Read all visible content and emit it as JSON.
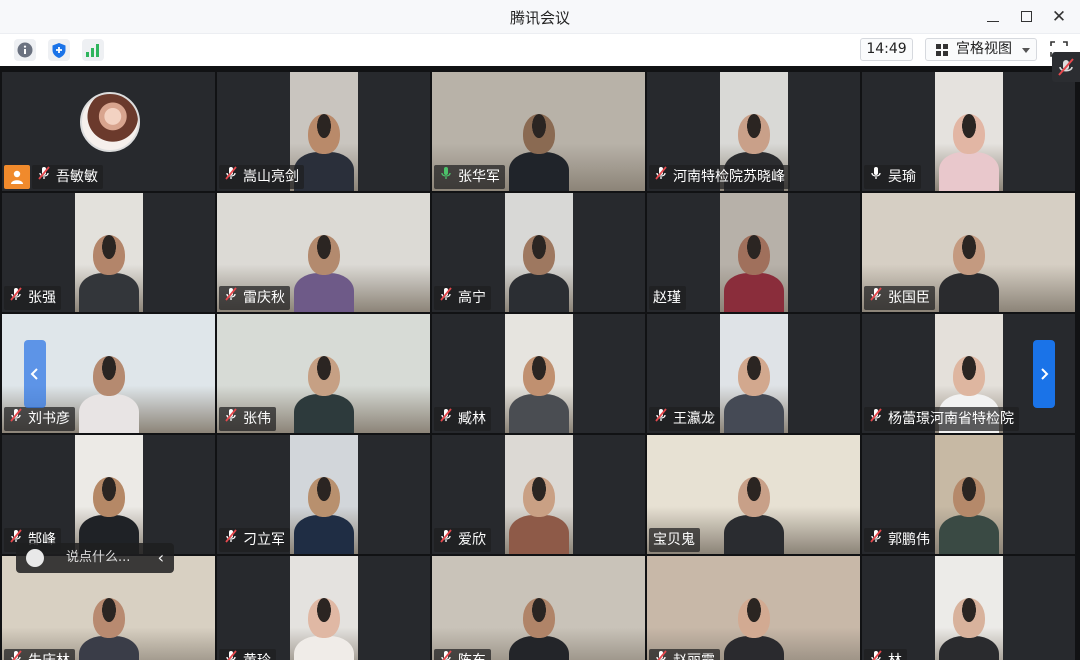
{
  "window": {
    "title": "腾讯会议"
  },
  "toolbar": {
    "time": "14:49",
    "view_label": "宫格视图"
  },
  "chat": {
    "placeholder": "说点什么..."
  },
  "participants": [
    {
      "name": "吾敏敏",
      "mic": "muted",
      "host": true
    },
    {
      "name": "嵩山亮剑",
      "mic": "muted"
    },
    {
      "name": "张华军",
      "mic": "speaking",
      "active": true
    },
    {
      "name": "河南特检院苏晓峰",
      "mic": "muted"
    },
    {
      "name": "吴瑜",
      "mic": "on"
    },
    {
      "name": "张强",
      "mic": "muted"
    },
    {
      "name": "雷庆秋",
      "mic": "muted"
    },
    {
      "name": "高宁",
      "mic": "muted"
    },
    {
      "name": "赵瑾",
      "mic": "none"
    },
    {
      "name": "张国臣",
      "mic": "muted"
    },
    {
      "name": "刘书彦",
      "mic": "muted"
    },
    {
      "name": "张伟",
      "mic": "muted"
    },
    {
      "name": "臧林",
      "mic": "muted"
    },
    {
      "name": "王瀛龙",
      "mic": "muted"
    },
    {
      "name": "杨蕾璟河南省特检院",
      "mic": "muted"
    },
    {
      "name": "郜峰",
      "mic": "muted"
    },
    {
      "name": "刁立军",
      "mic": "muted"
    },
    {
      "name": "爱欣",
      "mic": "muted"
    },
    {
      "name": "宝贝鬼",
      "mic": "none"
    },
    {
      "name": "郭鹏伟",
      "mic": "muted"
    },
    {
      "name": "朱庆林",
      "mic": "muted"
    },
    {
      "name": "黄玲",
      "mic": "muted"
    },
    {
      "name": "陈东",
      "mic": "muted"
    },
    {
      "name": "赵丽霞",
      "mic": "muted"
    },
    {
      "name": "林",
      "mic": "muted"
    }
  ],
  "colors": {
    "accent": "#1a73e8",
    "speaking": "#4cc36b",
    "muted": "#e5484d",
    "host": "#f08a2c"
  }
}
